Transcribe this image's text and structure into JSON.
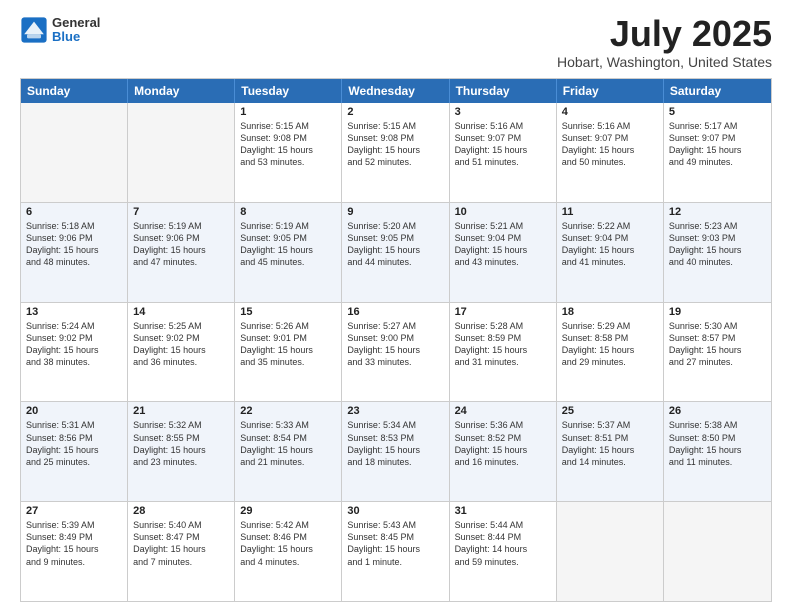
{
  "logo": {
    "general": "General",
    "blue": "Blue"
  },
  "title": {
    "month": "July 2025",
    "location": "Hobart, Washington, United States"
  },
  "header_days": [
    "Sunday",
    "Monday",
    "Tuesday",
    "Wednesday",
    "Thursday",
    "Friday",
    "Saturday"
  ],
  "weeks": [
    [
      {
        "day": "",
        "sunrise": "",
        "sunset": "",
        "daylight": "",
        "empty": true
      },
      {
        "day": "",
        "sunrise": "",
        "sunset": "",
        "daylight": "",
        "empty": true
      },
      {
        "day": "1",
        "sunrise": "Sunrise: 5:15 AM",
        "sunset": "Sunset: 9:08 PM",
        "daylight": "Daylight: 15 hours",
        "daylight2": "and 53 minutes.",
        "empty": false
      },
      {
        "day": "2",
        "sunrise": "Sunrise: 5:15 AM",
        "sunset": "Sunset: 9:08 PM",
        "daylight": "Daylight: 15 hours",
        "daylight2": "and 52 minutes.",
        "empty": false
      },
      {
        "day": "3",
        "sunrise": "Sunrise: 5:16 AM",
        "sunset": "Sunset: 9:07 PM",
        "daylight": "Daylight: 15 hours",
        "daylight2": "and 51 minutes.",
        "empty": false
      },
      {
        "day": "4",
        "sunrise": "Sunrise: 5:16 AM",
        "sunset": "Sunset: 9:07 PM",
        "daylight": "Daylight: 15 hours",
        "daylight2": "and 50 minutes.",
        "empty": false
      },
      {
        "day": "5",
        "sunrise": "Sunrise: 5:17 AM",
        "sunset": "Sunset: 9:07 PM",
        "daylight": "Daylight: 15 hours",
        "daylight2": "and 49 minutes.",
        "empty": false
      }
    ],
    [
      {
        "day": "6",
        "sunrise": "Sunrise: 5:18 AM",
        "sunset": "Sunset: 9:06 PM",
        "daylight": "Daylight: 15 hours",
        "daylight2": "and 48 minutes.",
        "empty": false
      },
      {
        "day": "7",
        "sunrise": "Sunrise: 5:19 AM",
        "sunset": "Sunset: 9:06 PM",
        "daylight": "Daylight: 15 hours",
        "daylight2": "and 47 minutes.",
        "empty": false
      },
      {
        "day": "8",
        "sunrise": "Sunrise: 5:19 AM",
        "sunset": "Sunset: 9:05 PM",
        "daylight": "Daylight: 15 hours",
        "daylight2": "and 45 minutes.",
        "empty": false
      },
      {
        "day": "9",
        "sunrise": "Sunrise: 5:20 AM",
        "sunset": "Sunset: 9:05 PM",
        "daylight": "Daylight: 15 hours",
        "daylight2": "and 44 minutes.",
        "empty": false
      },
      {
        "day": "10",
        "sunrise": "Sunrise: 5:21 AM",
        "sunset": "Sunset: 9:04 PM",
        "daylight": "Daylight: 15 hours",
        "daylight2": "and 43 minutes.",
        "empty": false
      },
      {
        "day": "11",
        "sunrise": "Sunrise: 5:22 AM",
        "sunset": "Sunset: 9:04 PM",
        "daylight": "Daylight: 15 hours",
        "daylight2": "and 41 minutes.",
        "empty": false
      },
      {
        "day": "12",
        "sunrise": "Sunrise: 5:23 AM",
        "sunset": "Sunset: 9:03 PM",
        "daylight": "Daylight: 15 hours",
        "daylight2": "and 40 minutes.",
        "empty": false
      }
    ],
    [
      {
        "day": "13",
        "sunrise": "Sunrise: 5:24 AM",
        "sunset": "Sunset: 9:02 PM",
        "daylight": "Daylight: 15 hours",
        "daylight2": "and 38 minutes.",
        "empty": false
      },
      {
        "day": "14",
        "sunrise": "Sunrise: 5:25 AM",
        "sunset": "Sunset: 9:02 PM",
        "daylight": "Daylight: 15 hours",
        "daylight2": "and 36 minutes.",
        "empty": false
      },
      {
        "day": "15",
        "sunrise": "Sunrise: 5:26 AM",
        "sunset": "Sunset: 9:01 PM",
        "daylight": "Daylight: 15 hours",
        "daylight2": "and 35 minutes.",
        "empty": false
      },
      {
        "day": "16",
        "sunrise": "Sunrise: 5:27 AM",
        "sunset": "Sunset: 9:00 PM",
        "daylight": "Daylight: 15 hours",
        "daylight2": "and 33 minutes.",
        "empty": false
      },
      {
        "day": "17",
        "sunrise": "Sunrise: 5:28 AM",
        "sunset": "Sunset: 8:59 PM",
        "daylight": "Daylight: 15 hours",
        "daylight2": "and 31 minutes.",
        "empty": false
      },
      {
        "day": "18",
        "sunrise": "Sunrise: 5:29 AM",
        "sunset": "Sunset: 8:58 PM",
        "daylight": "Daylight: 15 hours",
        "daylight2": "and 29 minutes.",
        "empty": false
      },
      {
        "day": "19",
        "sunrise": "Sunrise: 5:30 AM",
        "sunset": "Sunset: 8:57 PM",
        "daylight": "Daylight: 15 hours",
        "daylight2": "and 27 minutes.",
        "empty": false
      }
    ],
    [
      {
        "day": "20",
        "sunrise": "Sunrise: 5:31 AM",
        "sunset": "Sunset: 8:56 PM",
        "daylight": "Daylight: 15 hours",
        "daylight2": "and 25 minutes.",
        "empty": false
      },
      {
        "day": "21",
        "sunrise": "Sunrise: 5:32 AM",
        "sunset": "Sunset: 8:55 PM",
        "daylight": "Daylight: 15 hours",
        "daylight2": "and 23 minutes.",
        "empty": false
      },
      {
        "day": "22",
        "sunrise": "Sunrise: 5:33 AM",
        "sunset": "Sunset: 8:54 PM",
        "daylight": "Daylight: 15 hours",
        "daylight2": "and 21 minutes.",
        "empty": false
      },
      {
        "day": "23",
        "sunrise": "Sunrise: 5:34 AM",
        "sunset": "Sunset: 8:53 PM",
        "daylight": "Daylight: 15 hours",
        "daylight2": "and 18 minutes.",
        "empty": false
      },
      {
        "day": "24",
        "sunrise": "Sunrise: 5:36 AM",
        "sunset": "Sunset: 8:52 PM",
        "daylight": "Daylight: 15 hours",
        "daylight2": "and 16 minutes.",
        "empty": false
      },
      {
        "day": "25",
        "sunrise": "Sunrise: 5:37 AM",
        "sunset": "Sunset: 8:51 PM",
        "daylight": "Daylight: 15 hours",
        "daylight2": "and 14 minutes.",
        "empty": false
      },
      {
        "day": "26",
        "sunrise": "Sunrise: 5:38 AM",
        "sunset": "Sunset: 8:50 PM",
        "daylight": "Daylight: 15 hours",
        "daylight2": "and 11 minutes.",
        "empty": false
      }
    ],
    [
      {
        "day": "27",
        "sunrise": "Sunrise: 5:39 AM",
        "sunset": "Sunset: 8:49 PM",
        "daylight": "Daylight: 15 hours",
        "daylight2": "and 9 minutes.",
        "empty": false
      },
      {
        "day": "28",
        "sunrise": "Sunrise: 5:40 AM",
        "sunset": "Sunset: 8:47 PM",
        "daylight": "Daylight: 15 hours",
        "daylight2": "and 7 minutes.",
        "empty": false
      },
      {
        "day": "29",
        "sunrise": "Sunrise: 5:42 AM",
        "sunset": "Sunset: 8:46 PM",
        "daylight": "Daylight: 15 hours",
        "daylight2": "and 4 minutes.",
        "empty": false
      },
      {
        "day": "30",
        "sunrise": "Sunrise: 5:43 AM",
        "sunset": "Sunset: 8:45 PM",
        "daylight": "Daylight: 15 hours",
        "daylight2": "and 1 minute.",
        "empty": false
      },
      {
        "day": "31",
        "sunrise": "Sunrise: 5:44 AM",
        "sunset": "Sunset: 8:44 PM",
        "daylight": "Daylight: 14 hours",
        "daylight2": "and 59 minutes.",
        "empty": false
      },
      {
        "day": "",
        "sunrise": "",
        "sunset": "",
        "daylight": "",
        "daylight2": "",
        "empty": true
      },
      {
        "day": "",
        "sunrise": "",
        "sunset": "",
        "daylight": "",
        "daylight2": "",
        "empty": true
      }
    ]
  ]
}
